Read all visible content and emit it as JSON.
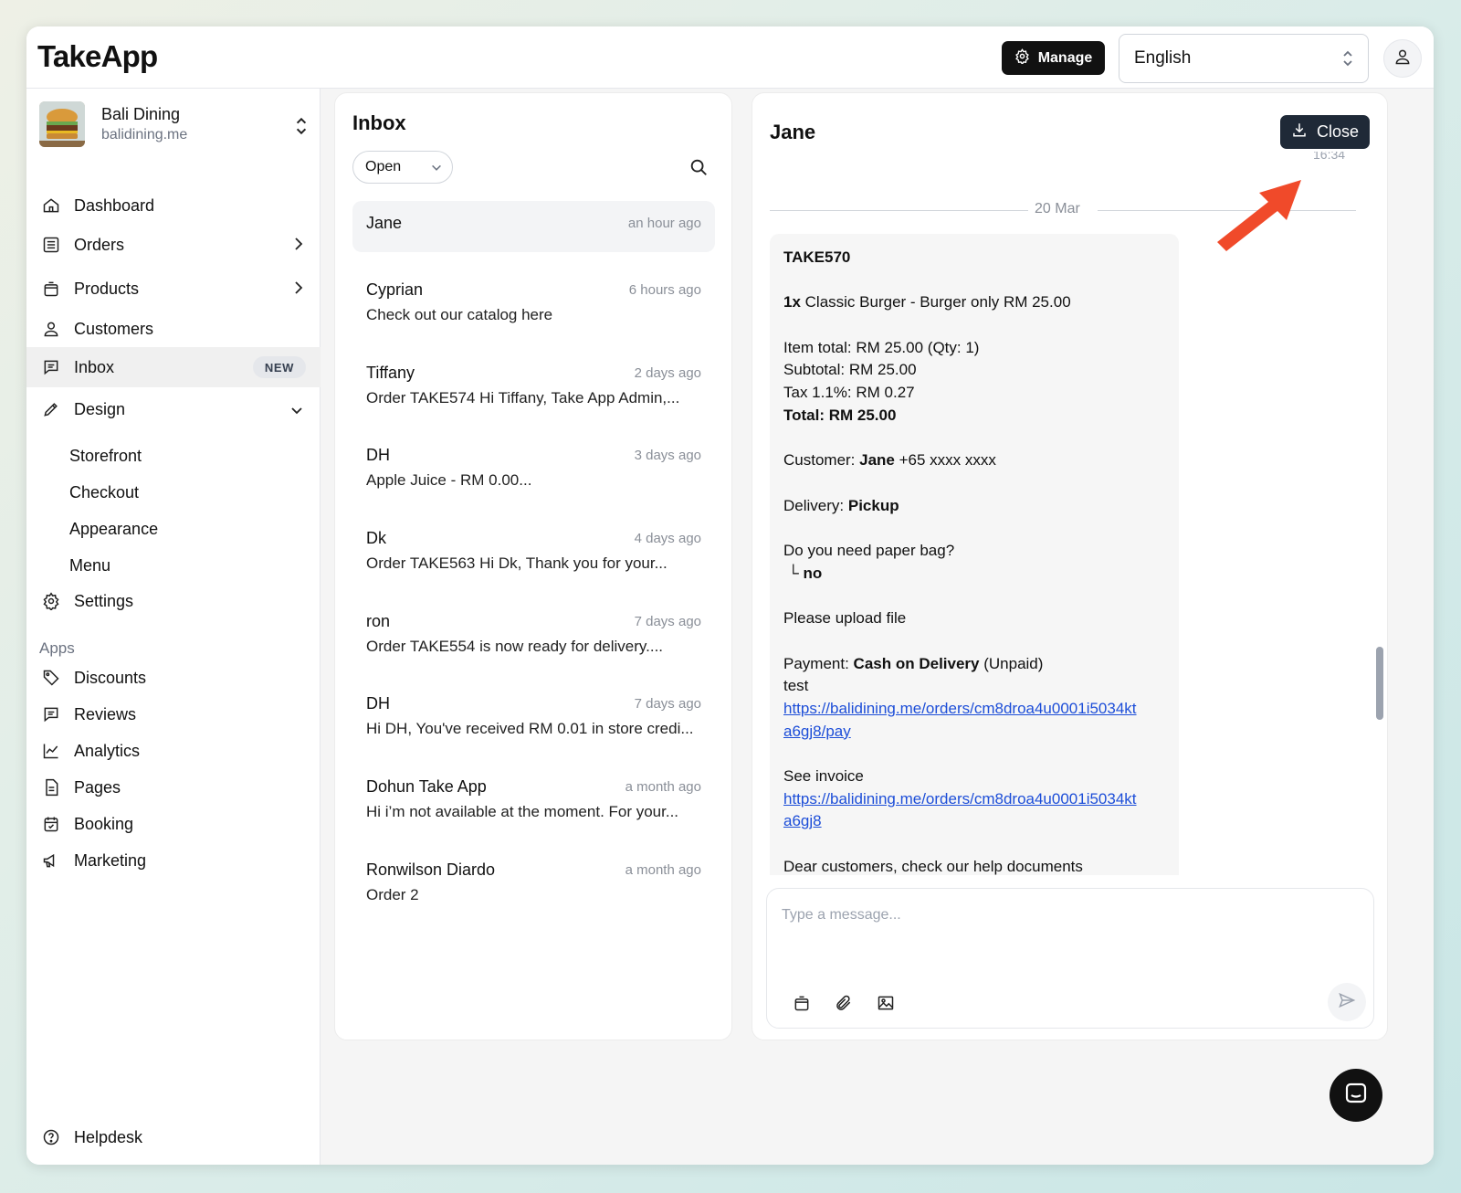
{
  "app": {
    "logo": "TakeApp"
  },
  "header": {
    "manage_label": "Manage",
    "language": "English"
  },
  "store": {
    "name": "Bali Dining",
    "url": "balidining.me"
  },
  "sidebar": {
    "items": [
      {
        "label": "Dashboard"
      },
      {
        "label": "Orders"
      },
      {
        "label": "Products"
      },
      {
        "label": "Customers"
      },
      {
        "label": "Inbox",
        "badge": "NEW"
      },
      {
        "label": "Design"
      },
      {
        "label": "Settings"
      }
    ],
    "design_subitems": [
      "Storefront",
      "Checkout",
      "Appearance",
      "Menu"
    ],
    "apps_label": "Apps",
    "apps": [
      {
        "label": "Discounts"
      },
      {
        "label": "Reviews"
      },
      {
        "label": "Analytics"
      },
      {
        "label": "Pages"
      },
      {
        "label": "Booking"
      },
      {
        "label": "Marketing"
      }
    ],
    "helpdesk": "Helpdesk"
  },
  "inbox": {
    "title": "Inbox",
    "filter": "Open",
    "conversations": [
      {
        "name": "Jane",
        "time": "an hour ago",
        "message": ""
      },
      {
        "name": "Cyprian",
        "time": "6 hours ago",
        "message": "Check out our catalog here"
      },
      {
        "name": "Tiffany",
        "time": "2 days ago",
        "message": "Order TAKE574 Hi Tiffany, Take App Admin,..."
      },
      {
        "name": "DH",
        "time": "3 days ago",
        "message": "Apple Juice - RM 0.00..."
      },
      {
        "name": "Dk",
        "time": "4 days ago",
        "message": "Order TAKE563 Hi Dk, Thank you for your..."
      },
      {
        "name": "ron",
        "time": "7 days ago",
        "message": "Order TAKE554 is now ready for delivery...."
      },
      {
        "name": "DH",
        "time": "7 days ago",
        "message": "Hi DH, You've received RM 0.01 in store credi..."
      },
      {
        "name": "Dohun Take App",
        "time": "a month ago",
        "message": "Hi i’m not available at the moment. For your..."
      },
      {
        "name": "Ronwilson Diardo",
        "time": "a month ago",
        "message": "Order 2"
      }
    ]
  },
  "chat": {
    "title": "Jane",
    "close_label": "Close",
    "prev_time": "16:34",
    "date_separator": "20 Mar",
    "order": {
      "code": "TAKE570",
      "item_qty": "1x",
      "item_line": " Classic Burger - Burger only RM 25.00",
      "item_total": "Item total: RM 25.00 (Qty: 1)",
      "subtotal": "Subtotal: RM 25.00",
      "tax": "Tax 1.1%: RM 0.27",
      "total": "Total: RM 25.00",
      "customer_label": "Customer: ",
      "customer_name": "Jane",
      "customer_phone": " +65 xxxx xxxx",
      "delivery_label": "Delivery: ",
      "delivery_value": "Pickup",
      "question": "Do you need paper bag?",
      "answer_prefix": "└ ",
      "answer": "no",
      "upload": "Please upload file",
      "payment_label": "Payment: ",
      "payment_method": "Cash on Delivery",
      "payment_status": " (Unpaid)",
      "note": "test",
      "pay_link_1": "https://balidining.me/orders/cm8droa4u0001i5034kt",
      "pay_link_2": "a6gj8/pay",
      "invoice_label": "See invoice",
      "invoice_link_1": "https://balidining.me/orders/cm8droa4u0001i5034kt",
      "invoice_link_2": "a6gj8",
      "footer": "Dear customers, check our help documents"
    },
    "composer_placeholder": "Type a message..."
  },
  "colors": {
    "accent": "#111111",
    "link": "#1d4ed8",
    "arrow": "#f04a2a"
  },
  "icons": [
    "gear-icon",
    "chevron-updown-icon",
    "user-icon",
    "home-icon",
    "list-icon",
    "bag-icon",
    "customer-icon",
    "message-icon",
    "pen-icon",
    "settings-icon",
    "tag-icon",
    "review-icon",
    "chart-icon",
    "page-icon",
    "calendar-icon",
    "megaphone-icon",
    "help-icon",
    "search-icon",
    "download-icon",
    "paperclip-icon",
    "image-icon",
    "send-icon",
    "chat-icon",
    "arrow-pointer"
  ]
}
